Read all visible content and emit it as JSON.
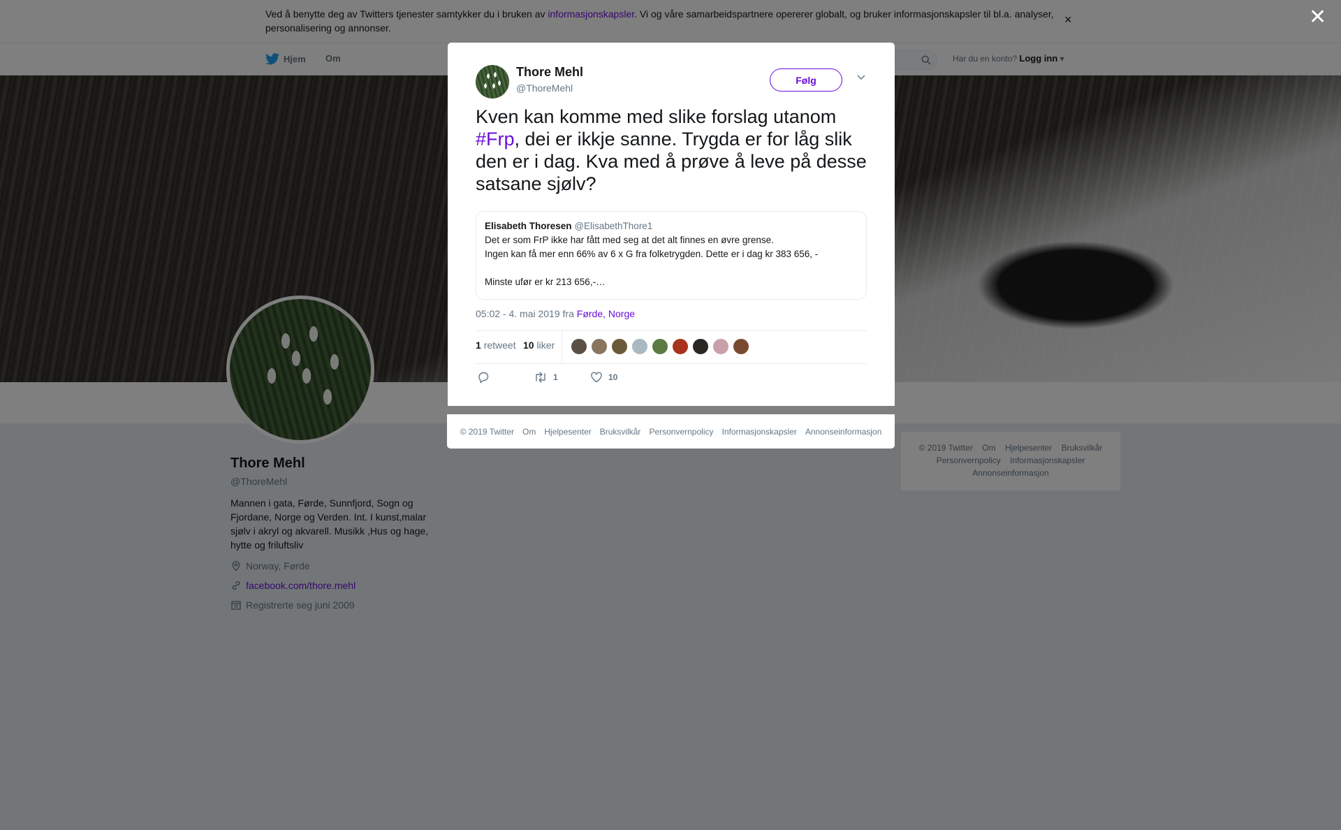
{
  "cookie_banner": {
    "text_before": "Ved å benytte deg av Twitters tjenester samtykker du i bruken av ",
    "link": "informasjonskapsler",
    "text_after": ". Vi og våre samarbeidspartnere opererer globalt, og bruker informasjonskapsler til bl.a. analyser, personalisering og annonser.",
    "close": "×"
  },
  "nav": {
    "home": "Hjem",
    "about": "Om",
    "login_prompt": "Har du en konto?",
    "login": "Logg inn"
  },
  "profile": {
    "name": "Thore Mehl",
    "handle": "@ThoreMehl",
    "bio": "Mannen i gata, Førde, Sunnfjord, Sogn og Fjordane, Norge og Verden. Int. I kunst,malar sjølv i akryl og akvarell. Musikk ,Hus og hage, hytte og friluftsliv",
    "location": "Norway, Førde",
    "url": "facebook.com/thore.mehl",
    "joined": "Registrerte seg juni 2009"
  },
  "tweet": {
    "author": "Thore Mehl",
    "handle": "@ThoreMehl",
    "follow_label": "Følg",
    "text_before": "Kven kan komme med slike forslag utanom ",
    "hashtag": "#Frp",
    "text_after": ", dei er ikkje sanne. Trygda er for låg slik den er i dag. Kva med å prøve å leve på desse satsane sjølv?",
    "quoted": {
      "name": "Elisabeth Thoresen",
      "handle": "@ElisabethThore1",
      "line1": "Det er som FrP ikke har fått med seg at det alt finnes en øvre grense.",
      "line2": "Ingen kan få mer enn 66% av 6 x G fra folketrygden. Dette er i dag kr 383 656, -",
      "line3": "Minste ufør er kr 213 656,-…"
    },
    "timestamp": "05:02 - 4. mai 2019 fra ",
    "place": "Førde, Norge",
    "retweets_count": "1",
    "retweets_label": "retweet",
    "likes_count": "10",
    "likes_label": "liker",
    "action_retweets": "1",
    "action_likes": "10",
    "liker_colors": [
      "#5a5046",
      "#8a7560",
      "#6b5a3a",
      "#aab8c2",
      "#5c7a44",
      "#a8321e",
      "#2a2624",
      "#c9a0a8",
      "#7a4a30"
    ]
  },
  "modal_footer": [
    "© 2019 Twitter",
    "Om",
    "Hjelpesenter",
    "Bruksvilkår",
    "Personvernpolicy",
    "Informasjonskapsler",
    "Annonseinformasjon"
  ],
  "right_footer": {
    "line1": [
      "© 2019 Twitter",
      "Om",
      "Hjelpesenter",
      "Bruksvilkår"
    ],
    "line2": [
      "Personvernpolicy",
      "Informasjonskapsler"
    ],
    "line3": [
      "Annonseinformasjon"
    ]
  },
  "overlay_close": "✕",
  "colors": {
    "accent": "#6a0fd9",
    "twitter_blue": "#1da1f2",
    "muted": "#657786"
  }
}
